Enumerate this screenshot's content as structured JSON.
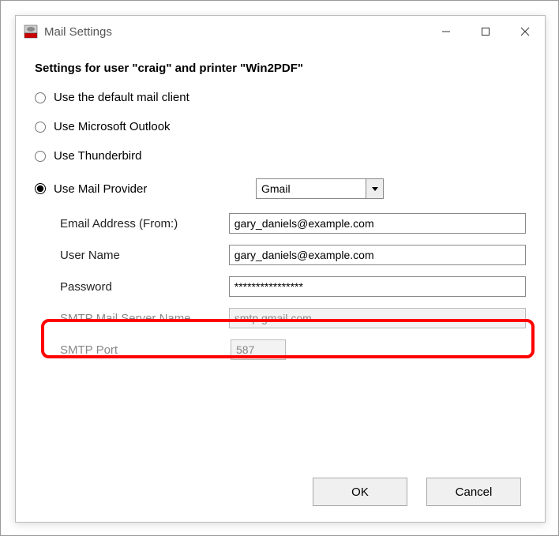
{
  "window": {
    "title": "Mail Settings"
  },
  "heading": "Settings for user \"craig\" and printer \"Win2PDF\"",
  "radios": {
    "default_client": "Use the default mail client",
    "outlook": "Use Microsoft Outlook",
    "thunderbird": "Use Thunderbird",
    "provider": "Use Mail Provider"
  },
  "provider": {
    "selected": "Gmail"
  },
  "fields": {
    "email_label": "Email Address (From:)",
    "email_value": "gary_daniels@example.com",
    "username_label": "User Name",
    "username_value": "gary_daniels@example.com",
    "password_label": "Password",
    "password_value": "****************",
    "smtp_server_label": "SMTP Mail Server Name",
    "smtp_server_value": "smtp.gmail.com",
    "smtp_port_label": "SMTP Port",
    "smtp_port_value": "587"
  },
  "buttons": {
    "ok": "OK",
    "cancel": "Cancel"
  }
}
